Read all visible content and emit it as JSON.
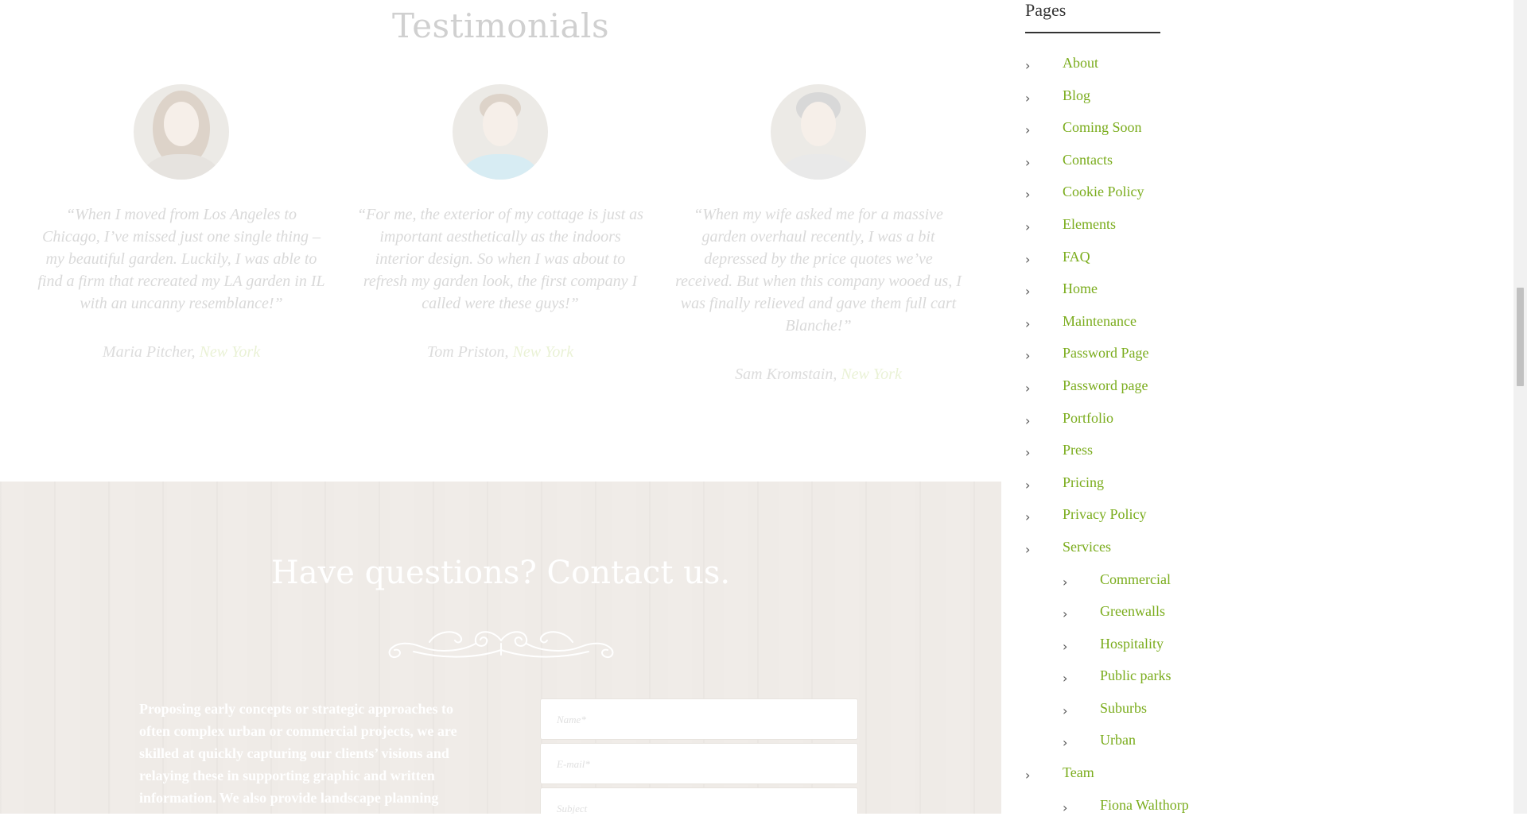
{
  "testimonials": {
    "title": "Testimonials",
    "items": [
      {
        "quote": "“When I moved from Los Angeles to Chicago, I’ve missed just one single thing – my beautiful garden. Luckily, I was able to find a firm that recreated my LA garden in IL with an uncanny resemblance!”",
        "name": "Maria Pitcher, ",
        "city": "New York"
      },
      {
        "quote": "“For me, the exterior of my cottage is just as important aesthetically as the indoors interior design. So when I was about to refresh my garden look, the first company I called were these guys!”",
        "name": "Tom Priston, ",
        "city": "New York"
      },
      {
        "quote": "“When my wife asked me for a massive garden overhaul recently, I was a bit depressed by the price quotes we’ve received. But when this company wooed us, I was finally relieved and gave them full cart Blanche!”",
        "name": "Sam Kromstain, ",
        "city": "New York"
      }
    ]
  },
  "contact": {
    "title": "Have questions? Contact us.",
    "text": "Proposing early concepts or strategic approaches to often complex urban or commercial projects, we are skilled at quickly capturing our clients’ visions and relaying these in supporting graphic and written information. We also provide landscape planning",
    "fields": {
      "name_placeholder": "Name*",
      "email_placeholder": "E-mail*",
      "subject_placeholder": "Subject"
    }
  },
  "sidebar": {
    "title": "Pages",
    "items": [
      {
        "label": "About"
      },
      {
        "label": "Blog"
      },
      {
        "label": "Coming Soon"
      },
      {
        "label": "Contacts"
      },
      {
        "label": "Cookie Policy"
      },
      {
        "label": "Elements"
      },
      {
        "label": "FAQ"
      },
      {
        "label": "Home"
      },
      {
        "label": "Maintenance"
      },
      {
        "label": "Password Page"
      },
      {
        "label": "Password page"
      },
      {
        "label": "Portfolio"
      },
      {
        "label": "Press"
      },
      {
        "label": "Pricing"
      },
      {
        "label": "Privacy Policy"
      },
      {
        "label": "Services"
      },
      {
        "label": "Commercial"
      },
      {
        "label": "Greenwalls"
      },
      {
        "label": "Hospitality"
      },
      {
        "label": "Public parks"
      },
      {
        "label": "Suburbs"
      },
      {
        "label": "Urban"
      },
      {
        "label": "Team"
      },
      {
        "label": "Fiona Walthorp"
      }
    ]
  },
  "colors": {
    "link": "#7aac1c",
    "contact_bg": "#efebe7",
    "heading": "#333333"
  },
  "icons": {
    "menu_bullet": "chevron-right-icon",
    "ornament": "flourish-divider"
  }
}
